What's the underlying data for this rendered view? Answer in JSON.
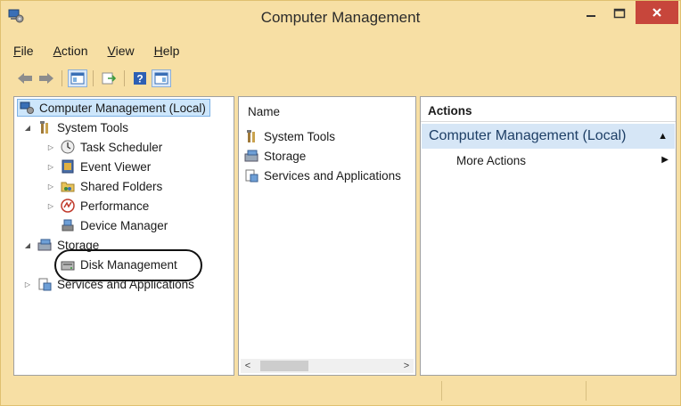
{
  "window": {
    "title": "Computer Management"
  },
  "menu": [
    {
      "label": "File",
      "accel": "F",
      "rest": "ile"
    },
    {
      "label": "Action",
      "accel": "A",
      "rest": "ction"
    },
    {
      "label": "View",
      "accel": "V",
      "rest": "iew"
    },
    {
      "label": "Help",
      "accel": "H",
      "rest": "elp"
    }
  ],
  "tree": {
    "root": "Computer Management (Local)",
    "system_tools": "System Tools",
    "task_scheduler": "Task Scheduler",
    "event_viewer": "Event Viewer",
    "shared_folders": "Shared Folders",
    "performance": "Performance",
    "device_manager": "Device Manager",
    "storage": "Storage",
    "disk_management": "Disk Management",
    "services_apps": "Services and Applications"
  },
  "middle": {
    "header": "Name",
    "items": [
      "System Tools",
      "Storage",
      "Services and Applications"
    ]
  },
  "actions": {
    "header": "Actions",
    "section": "Computer Management (Local)",
    "more": "More Actions"
  },
  "colors": {
    "frame": "#f7dfa4",
    "close": "#c7463b",
    "selection": "#cde6fb",
    "section": "#d6e6f6"
  }
}
